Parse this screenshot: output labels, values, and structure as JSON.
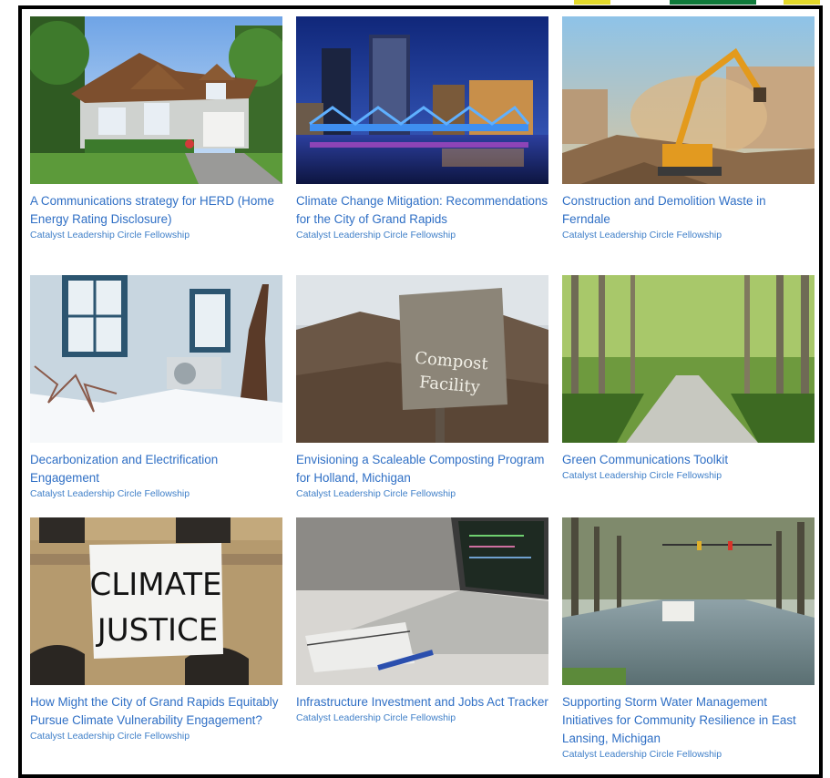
{
  "accent_color": "#2f6fc5",
  "cards": [
    {
      "title": "A Communications strategy for HERD (Home Energy Rating Disclosure)",
      "subtitle": "Catalyst Leadership Circle Fellowship"
    },
    {
      "title": "Climate Change Mitigation: Recommendations for the City of Grand Rapids",
      "subtitle": "Catalyst Leadership Circle Fellowship"
    },
    {
      "title": "Construction and Demolition Waste in Ferndale",
      "subtitle": "Catalyst Leadership Circle Fellowship"
    },
    {
      "title": "Decarbonization and Electrification Engagement",
      "subtitle": "Catalyst Leadership Circle Fellowship"
    },
    {
      "title": "Envisioning a Scaleable Composting Program for Holland, Michigan",
      "subtitle": "Catalyst Leadership Circle Fellowship",
      "sign_text_1": "Compost",
      "sign_text_2": "Facility"
    },
    {
      "title": "Green Communications Toolkit",
      "subtitle": "Catalyst Leadership Circle Fellowship"
    },
    {
      "title": "How Might the City of Grand Rapids Equitably Pursue Climate Vulnerability Engagement?",
      "subtitle": "Catalyst Leadership Circle Fellowship",
      "sign_text_1": "CLIMATE",
      "sign_text_2": "JUSTICE"
    },
    {
      "title": "Infrastructure Investment and Jobs Act Tracker",
      "subtitle": "Catalyst Leadership Circle Fellowship"
    },
    {
      "title": "Supporting Storm Water Management Initiatives for Community Resilience in East Lansing, Michigan",
      "subtitle": "Catalyst Leadership Circle Fellowship"
    }
  ]
}
